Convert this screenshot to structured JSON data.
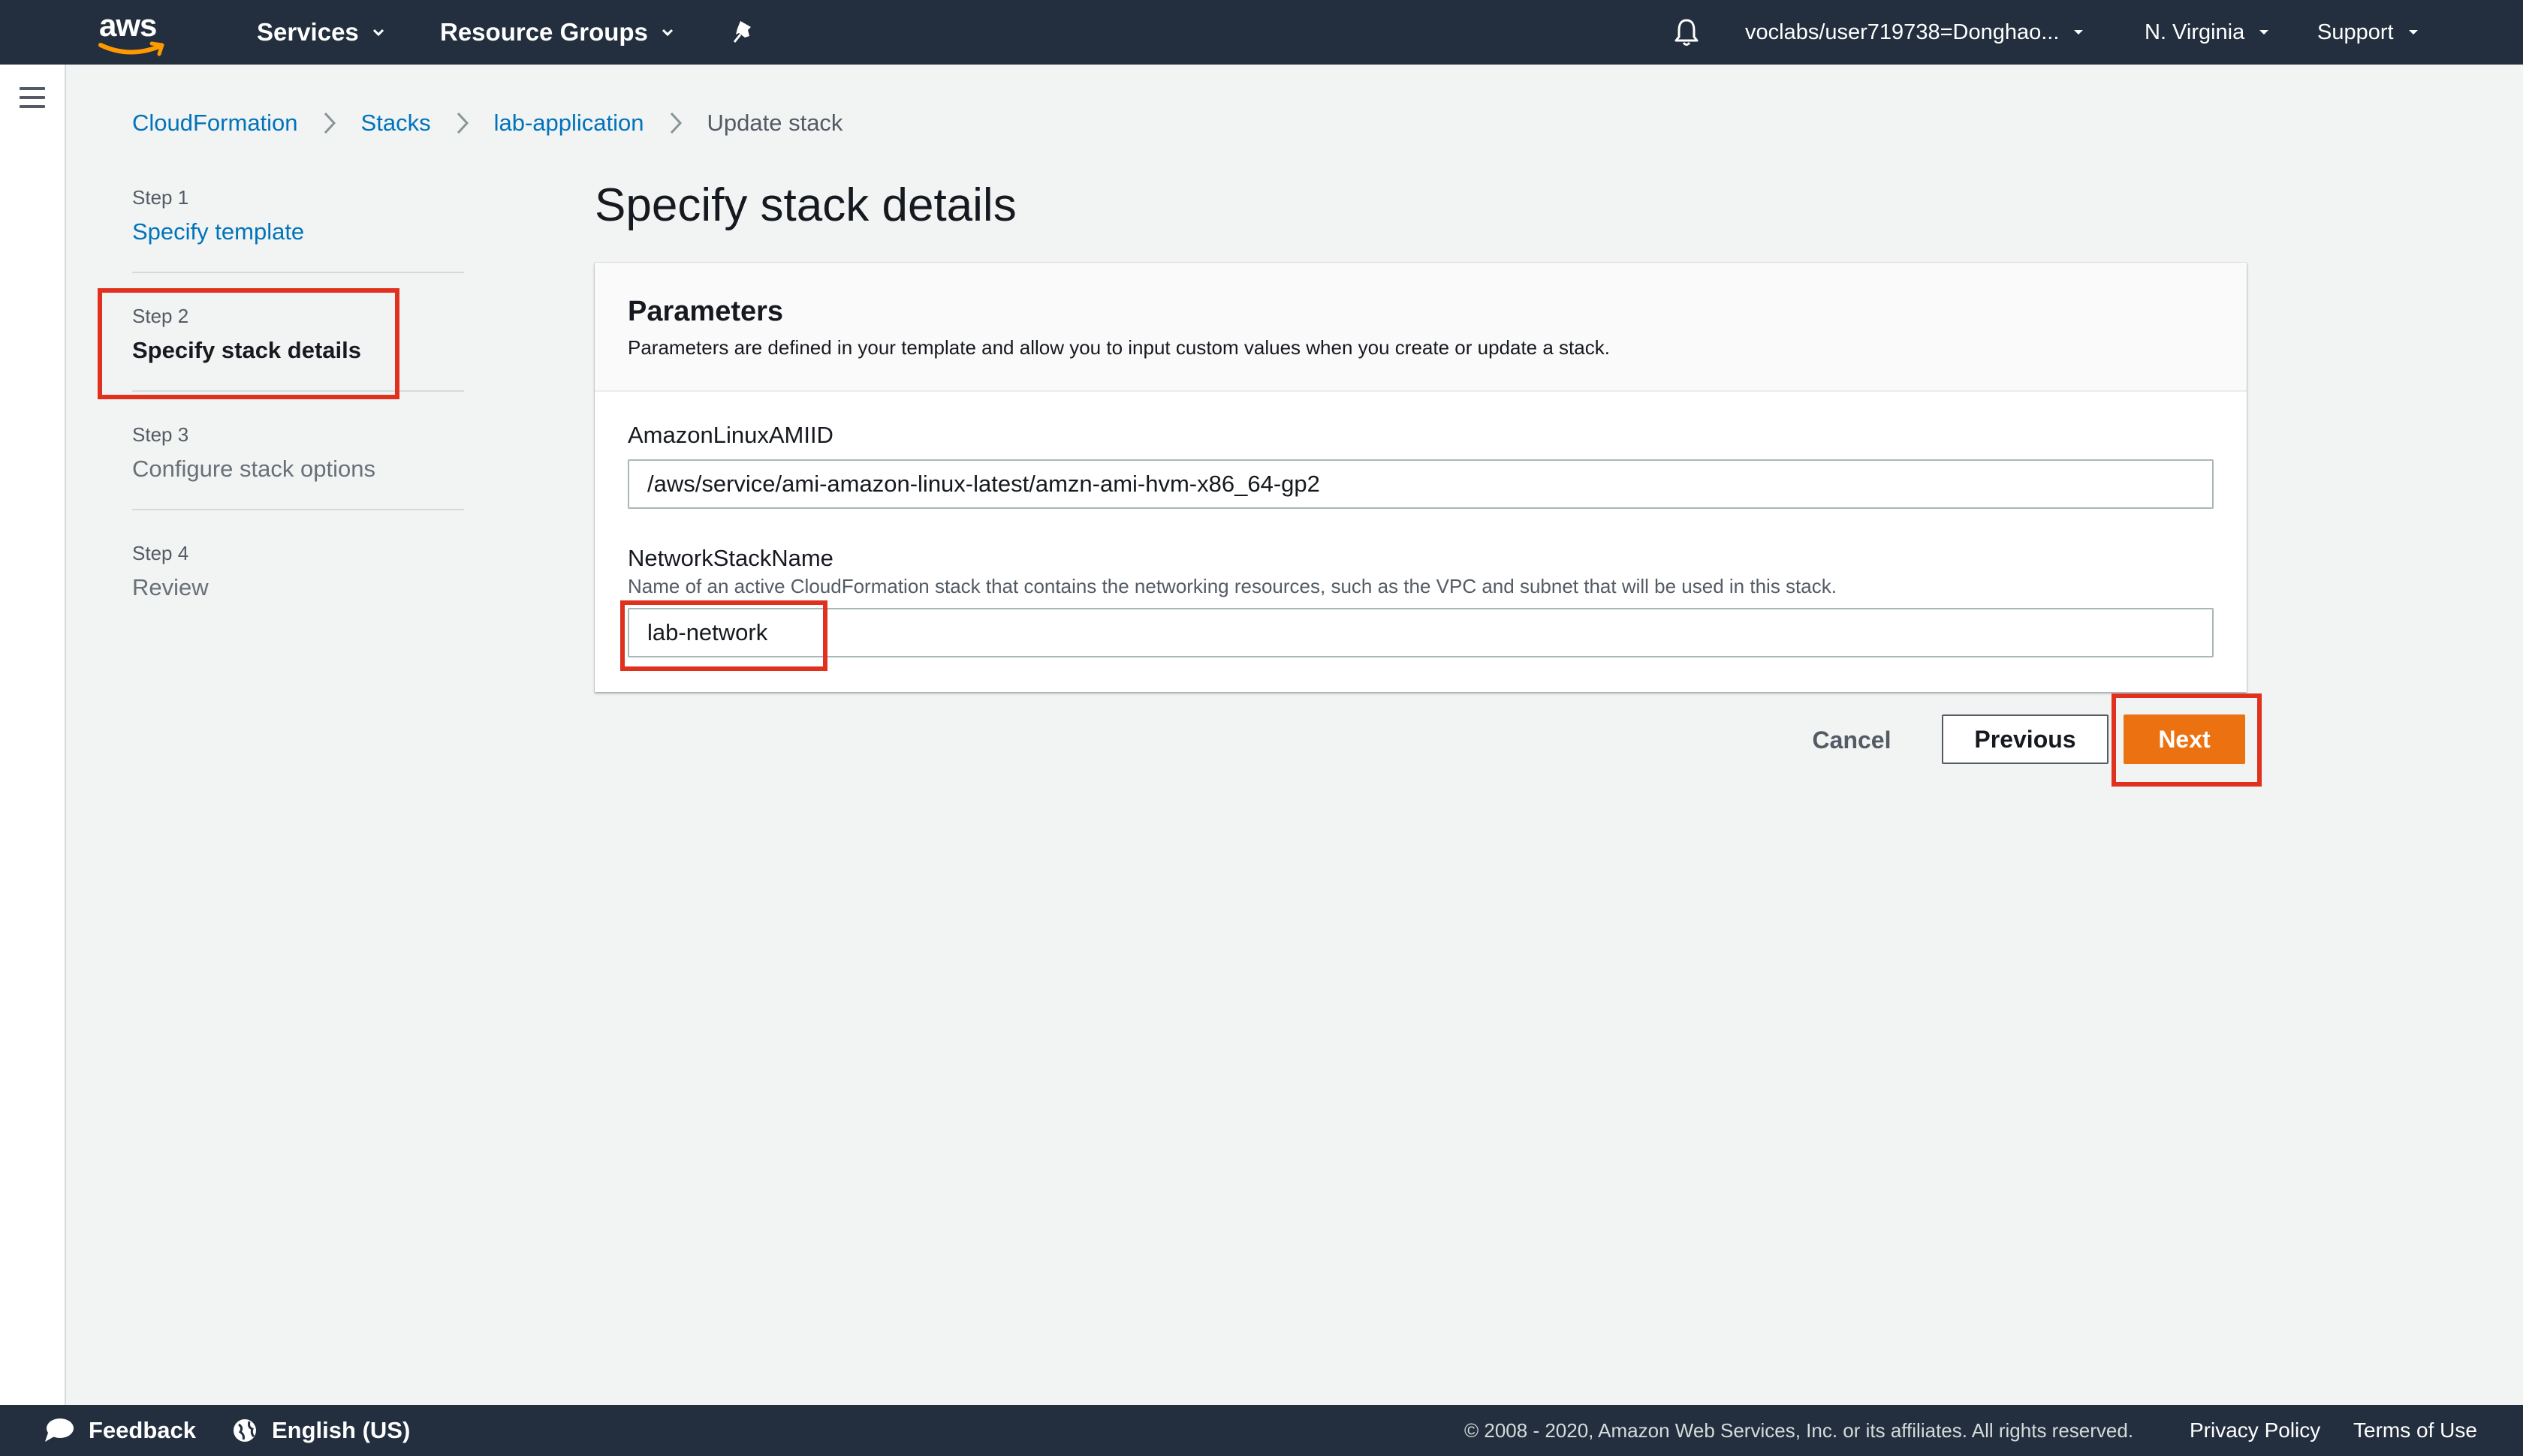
{
  "topnav": {
    "logo_text": "aws",
    "services_label": "Services",
    "resource_groups_label": "Resource Groups",
    "account_label": "voclabs/user719738=Donghao...",
    "region_label": "N. Virginia",
    "support_label": "Support",
    "icons": [
      "aws-logo",
      "chevron-down-icon",
      "pin-icon",
      "bell-icon"
    ]
  },
  "breadcrumb": {
    "items": [
      "CloudFormation",
      "Stacks",
      "lab-application"
    ],
    "current": "Update stack"
  },
  "steps": [
    {
      "num": "Step 1",
      "title": "Specify template",
      "state": "link"
    },
    {
      "num": "Step 2",
      "title": "Specify stack details",
      "state": "active"
    },
    {
      "num": "Step 3",
      "title": "Configure stack options",
      "state": "disabled"
    },
    {
      "num": "Step 4",
      "title": "Review",
      "state": "disabled"
    }
  ],
  "main": {
    "page_title": "Specify stack details",
    "panel_title": "Parameters",
    "panel_desc": "Parameters are defined in your template and allow you to input custom values when you create or update a stack.",
    "fields": [
      {
        "label": "AmazonLinuxAMIID",
        "description": "",
        "value": "/aws/service/ami-amazon-linux-latest/amzn-ami-hvm-x86_64-gp2"
      },
      {
        "label": "NetworkStackName",
        "description": "Name of an active CloudFormation stack that contains the networking resources, such as the VPC and subnet that will be used in this stack.",
        "value": "lab-network"
      }
    ]
  },
  "actions": {
    "cancel": "Cancel",
    "previous": "Previous",
    "next": "Next"
  },
  "footer": {
    "feedback": "Feedback",
    "language": "English (US)",
    "copyright": "© 2008 - 2020, Amazon Web Services, Inc. or its affiliates. All rights reserved.",
    "privacy": "Privacy Policy",
    "terms": "Terms of Use"
  },
  "colors": {
    "nav_bg": "#232f3e",
    "link": "#0073bb",
    "primary_button": "#ec7211",
    "highlight_box": "#e0301e",
    "page_bg": "#f2f3f3"
  }
}
